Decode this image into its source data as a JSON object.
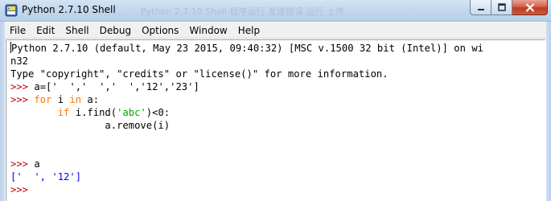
{
  "window": {
    "title": "Python 2.7.10 Shell",
    "background_title": "Python 2.7.10 Shell  程序运行 发送错误  运行 上传"
  },
  "menubar": {
    "items": [
      "File",
      "Edit",
      "Shell",
      "Debug",
      "Options",
      "Window",
      "Help"
    ]
  },
  "shell": {
    "banner_line1": "Python 2.7.10 (default, May 23 2015, 09:40:32) [MSC v.1500 32 bit (Intel)] on wi",
    "banner_line2": "n32",
    "banner_line3": "Type \"copyright\", \"credits\" or \"license()\" for more information.",
    "prompt": ">>> ",
    "cmd1": "a=['  ','  ','  ','12','23']",
    "cmd2_kw_for": "for",
    "cmd2_mid": " i ",
    "cmd2_kw_in": "in",
    "cmd2_end": " a:",
    "cmd3_indent": "        ",
    "cmd3_kw_if": "if",
    "cmd3_pre": " i.find(",
    "cmd3_str": "'abc'",
    "cmd3_post": ")<0:",
    "cmd4": "                a.remove(i)",
    "cmd5": "a",
    "output1": "['  ', '12']"
  },
  "colors": {
    "prompt": "#c00000",
    "keyword": "#ff7700",
    "string": "#00aa00",
    "output": "#0000ff"
  }
}
